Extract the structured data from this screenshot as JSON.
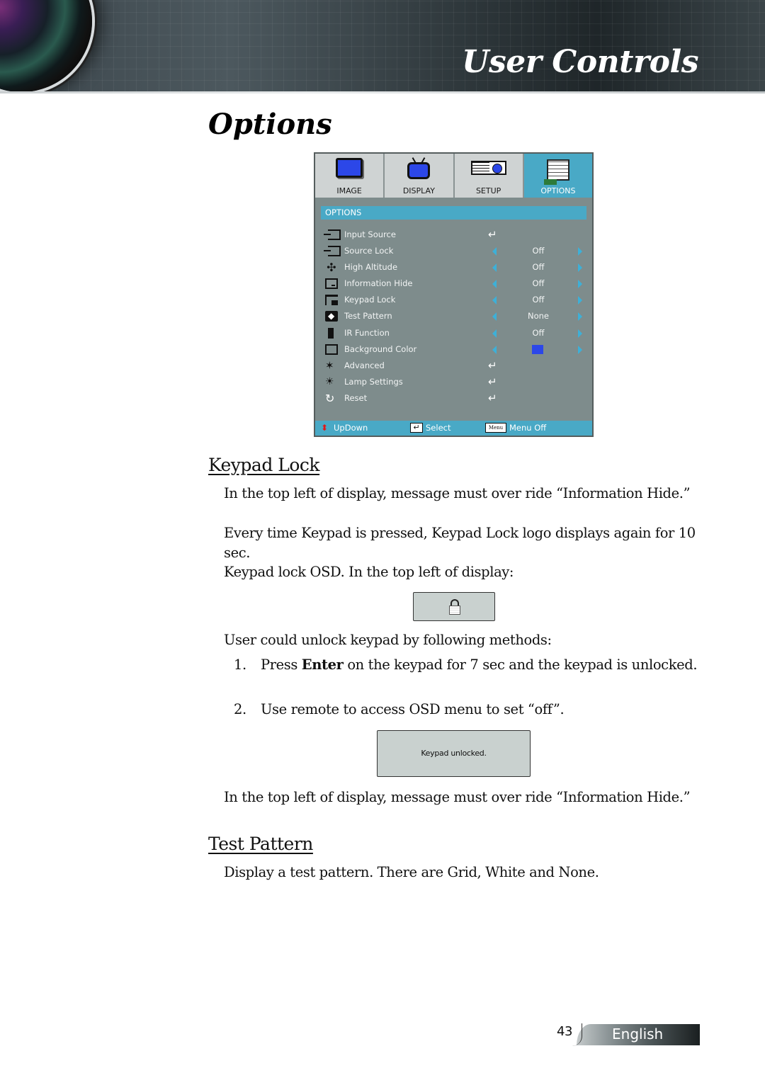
{
  "banner": {
    "title": "User Controls"
  },
  "page": {
    "section_title": "Options",
    "page_number": "43",
    "language": "English"
  },
  "osd": {
    "tabs": [
      {
        "label": "IMAGE",
        "icon": "monitor-icon",
        "active": false
      },
      {
        "label": "DISPLAY",
        "icon": "tv-icon",
        "active": false
      },
      {
        "label": "SETUP",
        "icon": "projector-icon",
        "active": false
      },
      {
        "label": "OPTIONS",
        "icon": "notepad-icon",
        "active": true
      }
    ],
    "header": "OPTIONS",
    "items": [
      {
        "label": "Input Source",
        "icon": "input-source-icon",
        "type": "enter",
        "enter_glyph": "↵"
      },
      {
        "label": "Source Lock",
        "icon": "source-lock-icon",
        "type": "select",
        "value": "Off"
      },
      {
        "label": "High Altitude",
        "icon": "fan-icon",
        "type": "select",
        "value": "Off"
      },
      {
        "label": "Information Hide",
        "icon": "info-hide-icon",
        "type": "select",
        "value": "Off"
      },
      {
        "label": "Keypad Lock",
        "icon": "keypad-icon",
        "type": "select",
        "value": "Off"
      },
      {
        "label": "Test Pattern",
        "icon": "test-pattern-icon",
        "type": "select",
        "value": "None"
      },
      {
        "label": "IR Function",
        "icon": "remote-icon",
        "type": "select",
        "value": "Off"
      },
      {
        "label": "Background Color",
        "icon": "background-color-icon",
        "type": "color",
        "value_color": "#2c47e8"
      },
      {
        "label": "Advanced",
        "icon": "advanced-icon",
        "type": "enter",
        "enter_glyph": "↵"
      },
      {
        "label": "Lamp Settings",
        "icon": "lamp-icon",
        "type": "enter",
        "enter_glyph": "↵"
      },
      {
        "label": "Reset",
        "icon": "reset-icon",
        "type": "enter",
        "enter_glyph": "↵"
      }
    ],
    "footer": {
      "updown_glyph": "⬍",
      "updown_label": "UpDown",
      "select_glyph": "↵",
      "select_label": "Select",
      "menu_key": "Menu",
      "menu_label": "Menu Off"
    },
    "colors": {
      "accent": "#49a9c6",
      "panel": "#7e8c8c",
      "arrow": "#3db0d8"
    }
  },
  "keypad_lock": {
    "heading": "Keypad Lock",
    "p1": "In the top left of display, message must over ride “Information Hide.”",
    "p2": "Every time Keypad is pressed, Keypad Lock logo displays again for 10 sec.",
    "p3": "Keypad lock OSD. In the top left of display:",
    "p4": "User could unlock keypad by following methods:",
    "steps": [
      {
        "num": "1.",
        "pre": "Press ",
        "bold": "Enter",
        "post": " on the keypad for 7 sec and the keypad is unlocked."
      },
      {
        "num": "2.",
        "pre": "Use remote to access OSD menu to set “off”.",
        "bold": "",
        "post": ""
      }
    ],
    "unlock_message": "Keypad unlocked.",
    "p5": "In the top left of display, message must over ride “Information Hide.”"
  },
  "test_pattern": {
    "heading": "Test Pattern",
    "p1": "Display a test pattern. There are Grid, White and None."
  }
}
